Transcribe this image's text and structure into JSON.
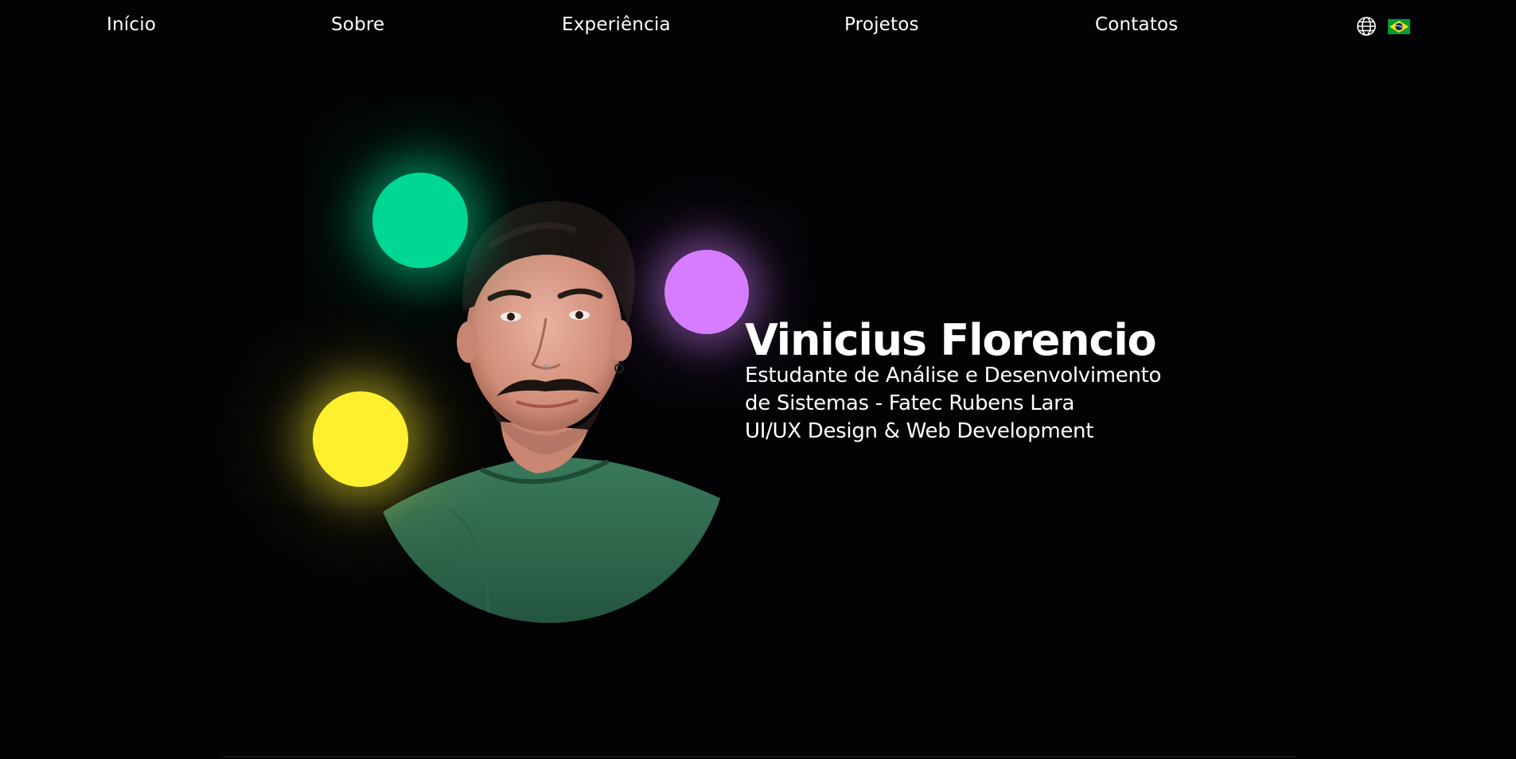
{
  "nav": {
    "items": [
      {
        "label": "Início"
      },
      {
        "label": "Sobre"
      },
      {
        "label": "Experiência"
      },
      {
        "label": "Projetos"
      },
      {
        "label": "Contatos"
      }
    ],
    "language": {
      "globe_icon": "globe-icon",
      "flag_icon": "brazil-flag-icon"
    }
  },
  "hero": {
    "name": "Vinicius Florencio",
    "subtitle_lines": [
      "Estudante de Análise e Desenvolvimento",
      "de Sistemas - Fatec Rubens Lara",
      "UI/UX Design & Web Development"
    ]
  },
  "colors": {
    "background": "#030305",
    "orb_green": "#00d792",
    "orb_purple": "#d57cff",
    "orb_yellow": "#fff02f",
    "shirt": "#2e6a4f"
  }
}
